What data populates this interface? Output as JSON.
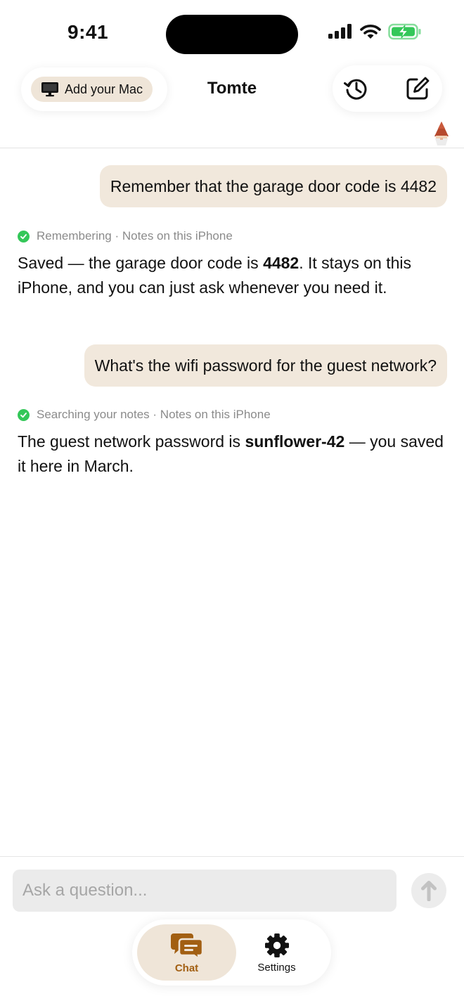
{
  "status_bar": {
    "time": "9:41",
    "icons": [
      "cellular-signal-icon",
      "wifi-icon",
      "battery-charging-icon"
    ]
  },
  "header": {
    "add_mac_label": "Add your Mac",
    "title": "Tomte",
    "actions": [
      "history-icon",
      "compose-icon"
    ]
  },
  "messages": [
    {
      "role": "user",
      "text": "Remember that the garage door code is 4482"
    },
    {
      "role": "assistant",
      "tool": {
        "action": "Remembering",
        "separator": "·",
        "source": "Notes on this iPhone"
      },
      "text_before": "Saved — the garage door code is ",
      "bold": "4482",
      "text_after": ". It stays on this iPhone, and you can just ask whenever you need it."
    },
    {
      "role": "user",
      "text": "What's the wifi password for the guest network?"
    },
    {
      "role": "assistant",
      "tool": {
        "action": "Searching your notes",
        "separator": "·",
        "source": "Notes on this iPhone"
      },
      "text_before": "The guest network password is ",
      "bold": "sunflower-42",
      "text_after": " — you saved it here in March."
    }
  ],
  "composer": {
    "placeholder": "Ask a question...",
    "value": ""
  },
  "tabs": [
    {
      "label": "Chat",
      "icon": "chat-bubbles-icon",
      "selected": true
    },
    {
      "label": "Settings",
      "icon": "gear-icon",
      "selected": false
    }
  ],
  "colors": {
    "accent": "#a25f12",
    "user_bubble": "#f1e8dc",
    "success": "#34c759"
  }
}
